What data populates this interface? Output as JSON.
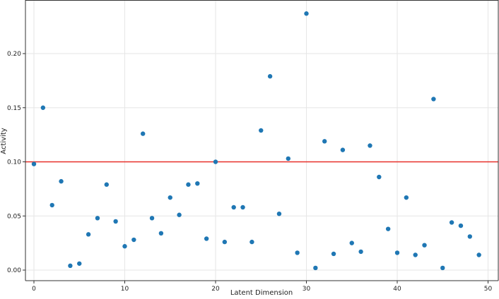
{
  "chart_data": {
    "type": "scatter",
    "title": "",
    "xlabel": "Latent Dimension",
    "ylabel": "Activity",
    "xlim": [
      -1,
      51
    ],
    "ylim": [
      -0.01,
      0.245
    ],
    "xticks": [
      0,
      10,
      20,
      30,
      40,
      50
    ],
    "xtick_labels": [
      "0",
      "10",
      "20",
      "30",
      "40",
      "50"
    ],
    "yticks": [
      0,
      0.05,
      0.1,
      0.15,
      0.2
    ],
    "ytick_labels": [
      "0.00",
      "0.05",
      "0.10",
      "0.15",
      "0.20"
    ],
    "grid": true,
    "point_color": "#1f77b4",
    "threshold": {
      "value": 0.1,
      "color": "#e8302a"
    },
    "x": [
      0,
      1,
      2,
      3,
      4,
      5,
      6,
      7,
      8,
      9,
      10,
      11,
      12,
      13,
      14,
      15,
      16,
      17,
      18,
      19,
      20,
      21,
      22,
      23,
      24,
      25,
      26,
      27,
      28,
      29,
      30,
      31,
      32,
      33,
      34,
      35,
      36,
      37,
      38,
      39,
      40,
      41,
      42,
      43,
      44,
      45,
      46,
      47,
      48,
      49
    ],
    "y": [
      0.098,
      0.15,
      0.06,
      0.082,
      0.004,
      0.006,
      0.033,
      0.048,
      0.079,
      0.045,
      0.022,
      0.028,
      0.126,
      0.048,
      0.034,
      0.067,
      0.051,
      0.079,
      0.08,
      0.029,
      0.1,
      0.026,
      0.058,
      0.058,
      0.026,
      0.129,
      0.179,
      0.052,
      0.103,
      0.016,
      0.237,
      0.002,
      0.119,
      0.015,
      0.111,
      0.025,
      0.017,
      0.115,
      0.086,
      0.038,
      0.016,
      0.067,
      0.014,
      0.023,
      0.158,
      0.002,
      0.044,
      0.041,
      0.031,
      0.014
    ]
  }
}
